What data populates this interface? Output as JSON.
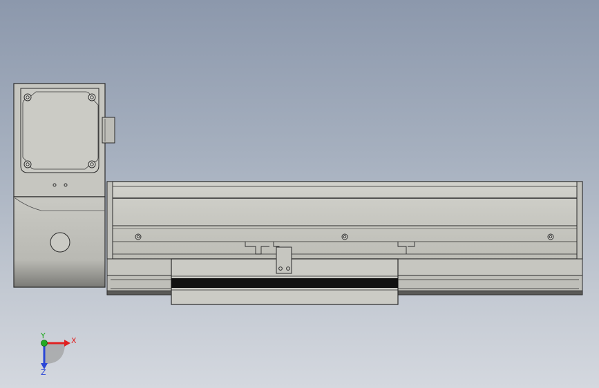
{
  "viewport": {
    "background_top": "#8c98ac",
    "background_bottom": "#d4d8df"
  },
  "model": {
    "part_fill": "#c8c8c2",
    "part_stroke": "#2a2a2a",
    "belt_color": "#111111"
  },
  "triad": {
    "x_label": "X",
    "y_label": "Y",
    "z_label": "Z",
    "x_color": "#e02020",
    "y_color": "#22aa22",
    "z_color": "#2a46d6"
  }
}
